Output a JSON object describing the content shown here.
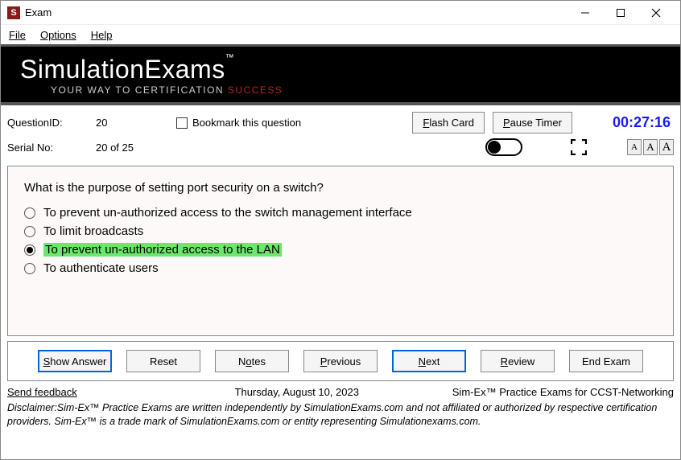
{
  "window": {
    "title": "Exam",
    "app_icon_letter": "S"
  },
  "menu": {
    "file": "File",
    "options": "Options",
    "help": "Help"
  },
  "banner": {
    "brand": "SimulationExams",
    "tm": "™",
    "tag1": "YOUR WAY",
    "tag2": " TO CERTIFICATION ",
    "tag3": "SUCCESS"
  },
  "info": {
    "qid_label": "QuestionID:",
    "qid_value": "20",
    "bookmark_label": "Bookmark this question",
    "serial_label": "Serial No:",
    "serial_value": "20 of 25",
    "flash_pre": "F",
    "flash_post": "lash Card",
    "pause_pre": "P",
    "pause_post": "ause Timer",
    "timer": "00:27:16",
    "font_a": "A"
  },
  "question": {
    "text": "What is the purpose of setting port security on a switch?",
    "options": [
      {
        "text": "To prevent un-authorized access to the switch management interface",
        "sel": false,
        "hl": false
      },
      {
        "text": "To limit broadcasts",
        "sel": false,
        "hl": false
      },
      {
        "text": "To prevent un-authorized access to the LAN",
        "sel": true,
        "hl": true
      },
      {
        "text": "To authenticate users",
        "sel": false,
        "hl": false
      }
    ]
  },
  "buttons": {
    "show_answer": {
      "u": "S",
      "rest": "how Answer"
    },
    "reset": {
      "u": "",
      "rest": "Reset"
    },
    "notes": {
      "u": "",
      "pre": "N",
      "urest": "o",
      "post": "tes"
    },
    "previous": {
      "u": "P",
      "rest": "revious"
    },
    "next": {
      "u": "N",
      "rest": "ext"
    },
    "review": {
      "u": "R",
      "rest": "eview"
    },
    "end": {
      "u": "",
      "rest": "End Exam"
    }
  },
  "status": {
    "feedback": "Send feedback",
    "date": "Thursday, August 10, 2023",
    "product": "Sim-Ex™ Practice Exams for CCST-Networking"
  },
  "disclaimer": "Disclaimer:Sim-Ex™ Practice Exams are written independently by SimulationExams.com and not affiliated or authorized by respective certification providers. Sim-Ex™ is a trade mark of SimulationExams.com or entity representing Simulationexams.com."
}
